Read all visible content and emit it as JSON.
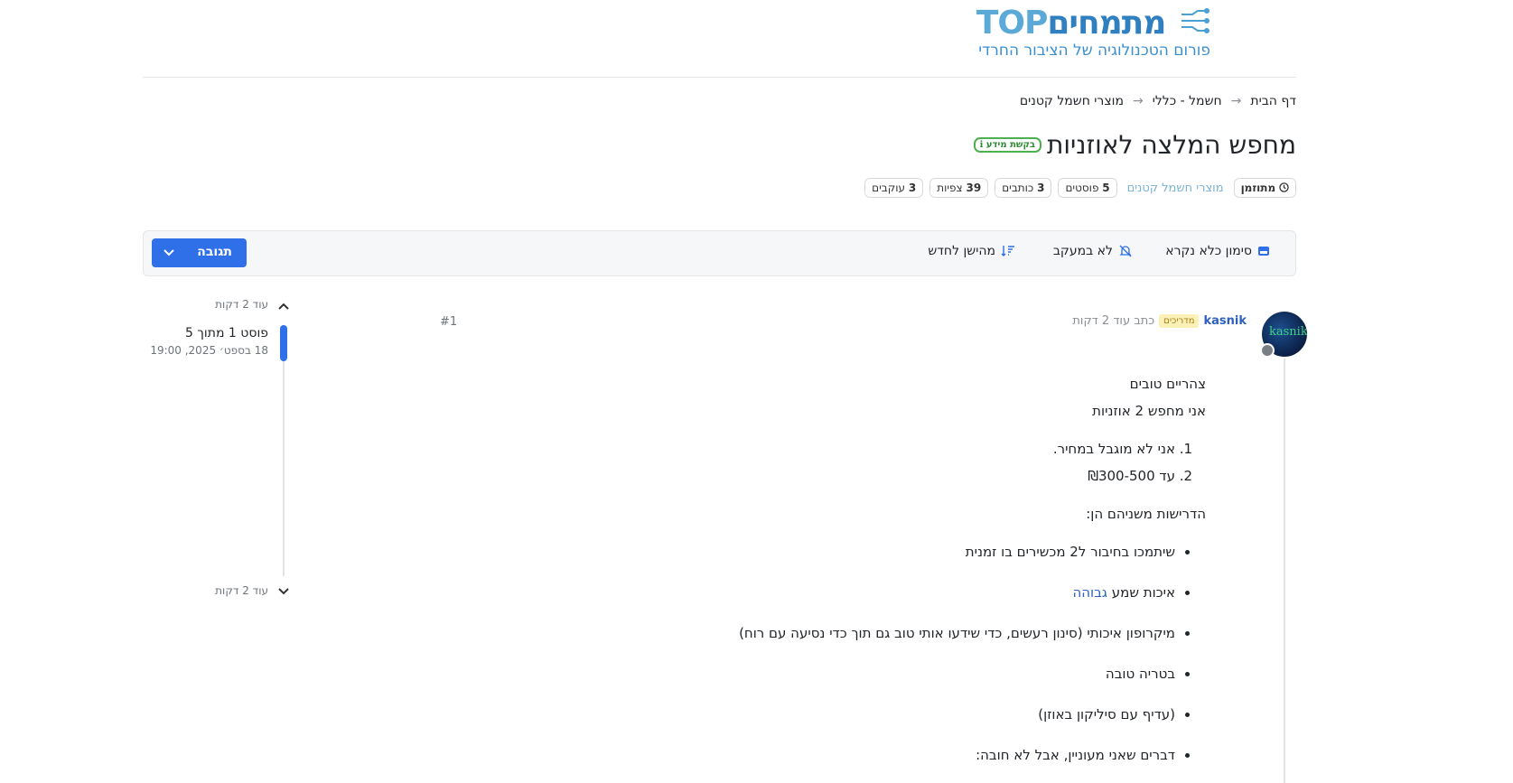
{
  "logo": {
    "main": "מתמחים",
    "top": "TOP",
    "subtitle": "פורום הטכנולוגיה של הציבור החרדי"
  },
  "breadcrumb": [
    "דף הבית",
    "חשמל - כללי",
    "מוצרי חשמל קטנים"
  ],
  "breadcrumb_sep": "→",
  "topic": {
    "title": "מחפש המלצה לאוזניות",
    "tag": "בקשת מידע"
  },
  "stats": {
    "status": "מתוזמן",
    "category": "מוצרי חשמל קטנים",
    "posts": "5",
    "posts_label": "פוסטים",
    "writers": "3",
    "writers_label": "כותבים",
    "views": "39",
    "views_label": "צפיות",
    "followers": "3",
    "followers_label": "עוקבים"
  },
  "toolbar": {
    "mark_read": "סימון כלא נקרא",
    "not_following": "לא במעקב",
    "sort": "מהישן לחדש",
    "reply": "תגובה"
  },
  "timeline": {
    "top_label": "עוד 2 דקות",
    "current": "פוסט 1 מתוך 5",
    "date": "18 בספט׳ 2025, 19:00",
    "bottom_label": "עוד 2 דקות"
  },
  "post": {
    "avatar_text": "kasnik",
    "username": "kasnik",
    "badge": "מדריכים",
    "wrote": "כתב עוד 2 דקות",
    "index": "#1",
    "greeting": "צהריים טובים",
    "intro": "אני מחפש 2 אוזניות",
    "ordered": [
      "אני לא מוגבל במחיר.",
      "עד ₪300-500"
    ],
    "requirements_title": "הדרישות משניהם הן:",
    "bullets": [
      "שיתמכו בחיבור ל2 מכשירים בו זמנית",
      "מיקרופון איכותי (סינון רעשים, כדי שידעו אותי טוב גם תוך כדי נסיעה עם רוח)",
      "בטריה טובה",
      "(עדיף עם סיליקון באוזן)",
      "דברים שאני מעוניין, אבל לא חובה:"
    ],
    "bullet_sound_prefix": "איכות שמע",
    "bullet_sound_highlight": "גבוהה"
  }
}
